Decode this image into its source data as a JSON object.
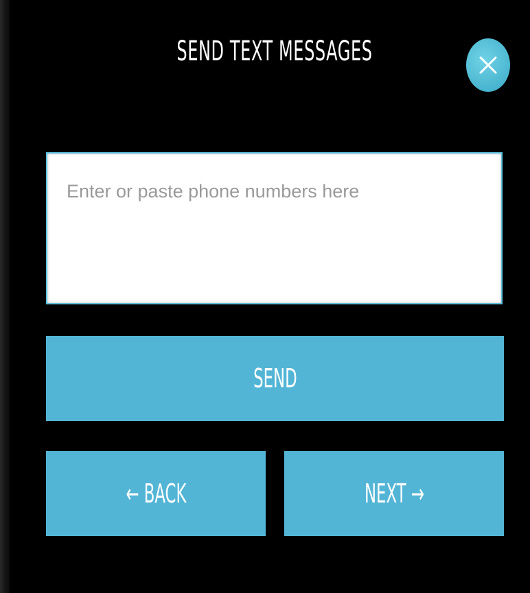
{
  "dialog": {
    "title": "SEND TEXT MESSAGES",
    "close_icon": "close-x-icon"
  },
  "phone_input": {
    "value": "",
    "placeholder": "Enter or paste phone numbers here"
  },
  "buttons": {
    "send_label": "SEND",
    "back_label": "← BACK",
    "next_label": "NEXT →"
  },
  "colors": {
    "accent": "#53b5d6",
    "close_button": "#4cc2d9",
    "modal_background": "#000000",
    "text": "#ffffff"
  }
}
